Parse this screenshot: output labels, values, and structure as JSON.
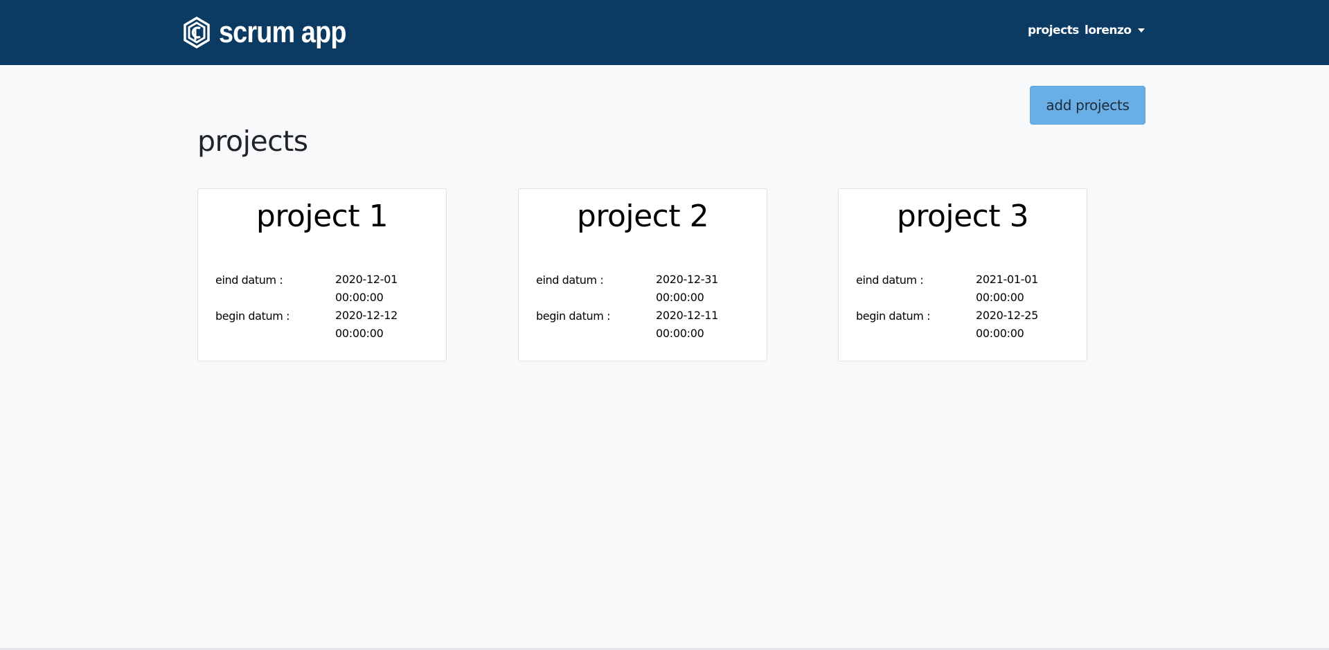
{
  "brand": {
    "name": "scrum app"
  },
  "nav": {
    "projects_label": "projects",
    "user_label": "lorenzo"
  },
  "toolbar": {
    "add_projects_label": "add projects"
  },
  "page": {
    "title": "projects"
  },
  "projects": [
    {
      "title": "project 1",
      "end_label": "eind datum :",
      "end_date": "2020-12-01 00:00:00",
      "begin_label": "begin datum :",
      "begin_date": "2020-12-12 00:00:00"
    },
    {
      "title": "project 2",
      "end_label": "eind datum :",
      "end_date": "2020-12-31 00:00:00",
      "begin_label": "begin datum :",
      "begin_date": "2020-12-11 00:00:00"
    },
    {
      "title": "project 3",
      "end_label": "eind datum :",
      "end_date": "2021-01-01 00:00:00",
      "begin_label": "begin datum :",
      "begin_date": "2020-12-25 00:00:00"
    }
  ],
  "colors": {
    "navbar": "#0b3a63",
    "accent_button": "#6aaee6",
    "background": "#f8f9fa"
  },
  "icons": {
    "brand": "scrum-hexagon-logo-icon",
    "user_menu": "caret-down-icon"
  }
}
